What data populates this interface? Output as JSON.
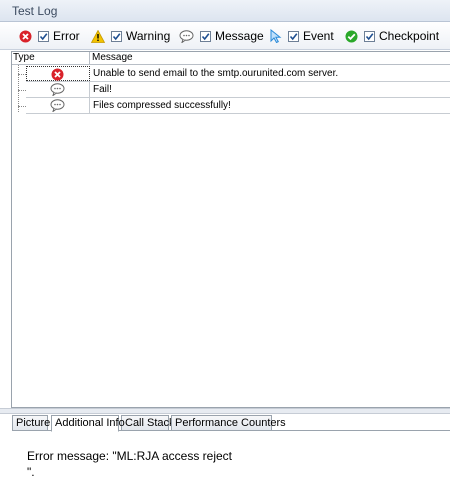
{
  "panel": {
    "title": "Test Log"
  },
  "filters": [
    {
      "label": "Error",
      "checked": true,
      "icon": "error-icon"
    },
    {
      "label": "Warning",
      "checked": true,
      "icon": "warning-icon"
    },
    {
      "label": "Message",
      "checked": true,
      "icon": "message-icon"
    },
    {
      "label": "Event",
      "checked": true,
      "icon": "event-icon"
    },
    {
      "label": "Checkpoint",
      "checked": true,
      "icon": "checkpoint-icon"
    }
  ],
  "log": {
    "columns": [
      "Type",
      "Message"
    ],
    "rows": [
      {
        "type": "error-icon",
        "message": "Unable to send email to the smtp.ourunited.com server.",
        "selected": true
      },
      {
        "type": "message-icon",
        "message": "Fail!"
      },
      {
        "type": "message-icon",
        "message": "Files compressed successfully!"
      }
    ]
  },
  "tabs": [
    "Picture",
    "Additional Info",
    "Call Stack",
    "Performance Counters"
  ],
  "active_tab": "Additional Info",
  "detail": {
    "line1": "Error message: \"ML:RJA access reject",
    "line2": "\"."
  },
  "colors": {
    "error": "#d9232b",
    "warning": "#f2c200",
    "event": "#2a8ad8",
    "checkpoint": "#2aa82a"
  }
}
